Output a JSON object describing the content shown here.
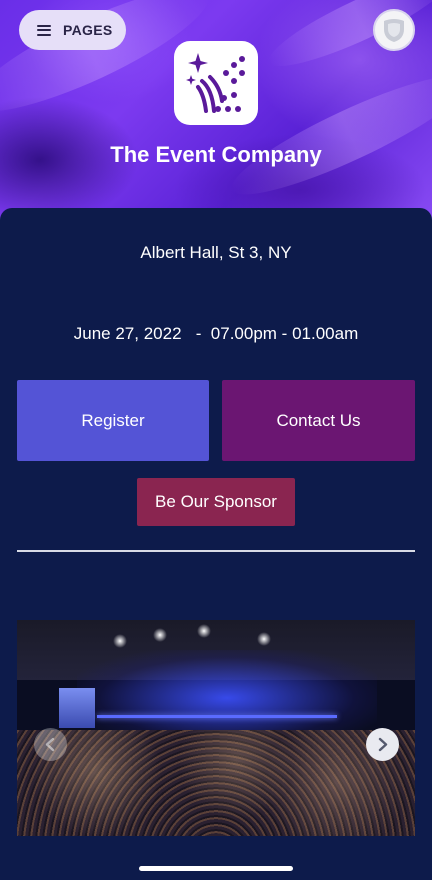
{
  "header": {
    "pages_label": "PAGES",
    "company_name": "The Event Company",
    "icons": {
      "menu": "menu-icon",
      "logo": "fireworks-icon",
      "avatar": "user-avatar-icon"
    }
  },
  "event": {
    "address": "Albert Hall, St 3, NY",
    "datetime": "June 27, 2022   -  07.00pm - 01.00am"
  },
  "actions": {
    "register_label": "Register",
    "contact_label": "Contact Us",
    "sponsor_label": "Be Our Sponsor"
  },
  "gallery": {
    "prev_icon": "chevron-left-icon",
    "next_icon": "chevron-right-icon"
  },
  "colors": {
    "background": "#0d1b4b",
    "register": "#5454d6",
    "contact": "#6b1672",
    "sponsor": "#8a2550",
    "hero": "#6a2ee8"
  }
}
